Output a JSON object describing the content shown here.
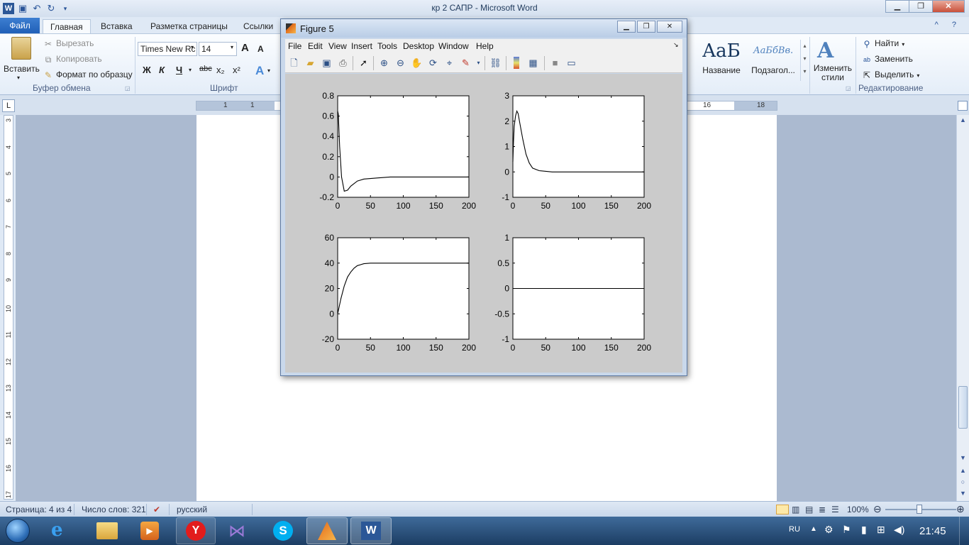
{
  "word": {
    "title": "кр 2 САПР  -  Microsoft Word",
    "tabs": [
      "Файл",
      "Главная",
      "Вставка",
      "Разметка страницы",
      "Ссылки"
    ],
    "active_tab": "Главная",
    "clipboard": {
      "paste": "Вставить",
      "cut": "Вырезать",
      "copy": "Копировать",
      "format_painter": "Формат по образцу",
      "group_label": "Буфер обмена"
    },
    "font": {
      "name": "Times New Rc",
      "size": "14",
      "group_label": "Шрифт",
      "bold": "Ж",
      "italic": "К",
      "underline": "Ч",
      "strike": "abc",
      "sub": "x₂",
      "sup": "x²",
      "grow": "A",
      "shrink": "A"
    },
    "styles": [
      {
        "preview": "AaБ",
        "label": "Название"
      },
      {
        "preview": "АаБбВв.",
        "label": "Подзагол..."
      }
    ],
    "change_styles": "Изменить стили",
    "editing": {
      "find": "Найти",
      "replace": "Заменить",
      "select": "Выделить",
      "group_label": "Редактирование"
    },
    "ruler_h": [
      "1",
      "2",
      "1",
      "16",
      "18"
    ],
    "ruler_v": [
      "3",
      "4",
      "5",
      "6",
      "7",
      "8",
      "9",
      "10",
      "11",
      "12",
      "13",
      "14",
      "15",
      "16",
      "17"
    ],
    "status": {
      "page": "Страница: 4 из 4",
      "words": "Число слов: 321",
      "lang": "русский",
      "zoom": "100%"
    }
  },
  "figure": {
    "title": "Figure 5",
    "menu": [
      "File",
      "Edit",
      "View",
      "Insert",
      "Tools",
      "Desktop",
      "Window",
      "Help"
    ],
    "toolbar_icons": [
      "new-figure-icon",
      "open-file-icon",
      "save-icon",
      "print-icon",
      "pointer-icon",
      "zoom-in-icon",
      "zoom-out-icon",
      "pan-icon",
      "rotate-3d-icon",
      "data-cursor-icon",
      "brush-icon",
      "link-plot-icon",
      "colorbar-icon",
      "legend-icon",
      "hide-plot-tools-icon",
      "show-plot-tools-icon"
    ]
  },
  "chart_data": [
    {
      "type": "line",
      "title": "",
      "xlabel": "",
      "ylabel": "",
      "xlim": [
        0,
        200
      ],
      "ylim": [
        -0.2,
        0.8
      ],
      "xticks": [
        "0",
        "50",
        "100",
        "150",
        "200"
      ],
      "yticks": [
        "-0.2",
        "0",
        "0.2",
        "0.4",
        "0.6",
        "0.8"
      ],
      "series": [
        {
          "x": [
            0,
            1,
            3,
            6,
            10,
            15,
            20,
            30,
            40,
            60,
            80,
            100,
            150,
            200
          ],
          "y": [
            0.65,
            0.62,
            0.3,
            0.0,
            -0.14,
            -0.13,
            -0.09,
            -0.04,
            -0.02,
            -0.01,
            0.0,
            0.0,
            0.0,
            0.0
          ]
        }
      ]
    },
    {
      "type": "line",
      "title": "",
      "xlabel": "",
      "ylabel": "",
      "xlim": [
        0,
        200
      ],
      "ylim": [
        -1,
        3
      ],
      "xticks": [
        "0",
        "50",
        "100",
        "150",
        "200"
      ],
      "yticks": [
        "-1",
        "0",
        "1",
        "2",
        "3"
      ],
      "series": [
        {
          "x": [
            0,
            1,
            2,
            4,
            6,
            8,
            10,
            15,
            20,
            25,
            30,
            40,
            60,
            80,
            100,
            150,
            200
          ],
          "y": [
            0.4,
            1.2,
            1.8,
            2.2,
            2.4,
            2.3,
            2.0,
            1.3,
            0.7,
            0.35,
            0.15,
            0.05,
            0.0,
            0.0,
            0.0,
            0.0,
            0.0
          ]
        }
      ]
    },
    {
      "type": "line",
      "title": "",
      "xlabel": "",
      "ylabel": "",
      "xlim": [
        0,
        200
      ],
      "ylim": [
        -20,
        60
      ],
      "xticks": [
        "0",
        "50",
        "100",
        "150",
        "200"
      ],
      "yticks": [
        "-20",
        "0",
        "20",
        "40",
        "60"
      ],
      "series": [
        {
          "x": [
            0,
            5,
            10,
            15,
            20,
            25,
            30,
            40,
            50,
            60,
            80,
            100,
            150,
            200
          ],
          "y": [
            0,
            12,
            22,
            29,
            33,
            36,
            38,
            39.5,
            40,
            40,
            40,
            40,
            40,
            40
          ]
        }
      ]
    },
    {
      "type": "line",
      "title": "",
      "xlabel": "",
      "ylabel": "",
      "xlim": [
        0,
        200
      ],
      "ylim": [
        -1,
        1
      ],
      "xticks": [
        "0",
        "50",
        "100",
        "150",
        "200"
      ],
      "yticks": [
        "-1",
        "-0.5",
        "0",
        "0.5",
        "1"
      ],
      "series": [
        {
          "x": [
            0,
            200
          ],
          "y": [
            0,
            0
          ]
        }
      ]
    }
  ],
  "taskbar": {
    "lang": "RU",
    "time": "21:45",
    "apps": [
      "start-orb-icon",
      "internet-explorer-icon",
      "file-explorer-icon",
      "media-player-icon",
      "yandex-browser-icon",
      "visual-studio-icon",
      "skype-icon",
      "matlab-icon",
      "word-icon"
    ]
  }
}
